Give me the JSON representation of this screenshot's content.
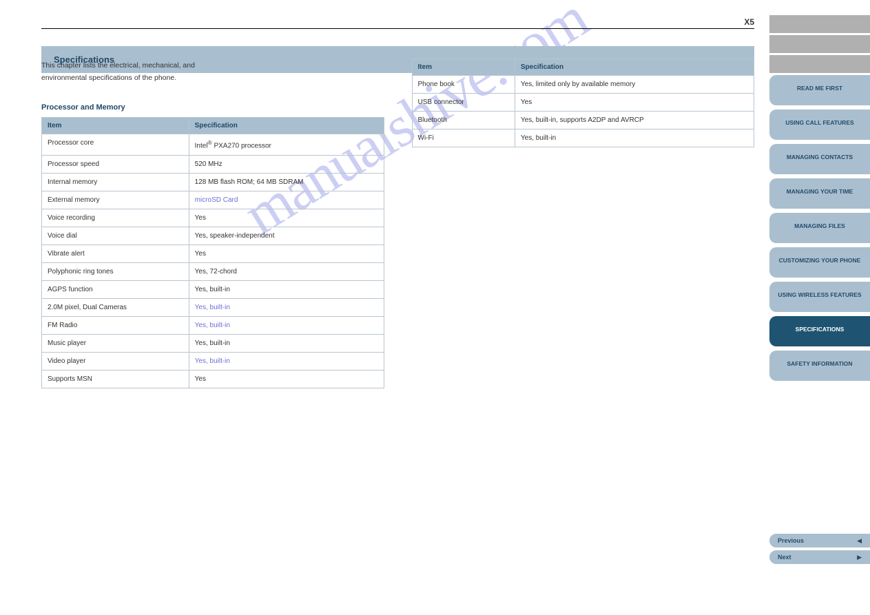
{
  "page_header": "X5",
  "section_title": "Specifications",
  "intro_lines": [
    "This chapter lists the electrical, mechanical, and",
    "environmental specifications of the phone."
  ],
  "left": {
    "subtitle": "Processor and Memory",
    "table": {
      "header_item": "Item",
      "header_spec": "Specification",
      "rows": [
        {
          "k": "Processor core",
          "v": "Intel<sup>®</sup>  PXA270 processor",
          "link": false
        },
        {
          "k": "Processor speed",
          "v": "520 MHz",
          "link": false
        },
        {
          "k": "Internal memory",
          "v": "128 MB flash ROM; 64 MB SDRAM",
          "link": false
        },
        {
          "k": "External memory",
          "v": "microSD Card",
          "link": "https://manualshive.com/"
        },
        {
          "k": "Voice recording",
          "v": "Yes",
          "link": false
        },
        {
          "k": "Voice dial",
          "v": "Yes, speaker-independent",
          "link": false
        },
        {
          "k": "Vibrate alert",
          "v": "Yes",
          "link": false
        },
        {
          "k": "Polyphonic ring tones",
          "v": "Yes, 72-chord",
          "link": false
        },
        {
          "k": "AGPS function",
          "v": "Yes, built-in",
          "link": false
        },
        {
          "k": "2.0M pixel, Dual Cameras",
          "v": "Yes, built-in",
          "link": "https://manualshive.com/"
        },
        {
          "k": "FM Radio",
          "v": "Yes, built-in",
          "link": "https://manualshive.com/"
        },
        {
          "k": "Music player",
          "v": "Yes, built-in",
          "link": false
        },
        {
          "k": "Video player",
          "v": "Yes, built-in",
          "link": "https://manualshive.com/"
        },
        {
          "k": "Supports MSN",
          "v": "Yes",
          "link": false
        }
      ]
    }
  },
  "right": {
    "table": {
      "header_item": "Item",
      "header_spec": "Specification",
      "rows": [
        {
          "k": "Phone book",
          "v": "Yes, limited only by available memory"
        },
        {
          "k": "USB connector",
          "v": "Yes"
        },
        {
          "k": "Bluetooth",
          "v": "Yes, built-in, supports A2DP and AVRCP"
        },
        {
          "k": "Wi-Fi",
          "v": "Yes, built-in"
        }
      ]
    }
  },
  "sidebar": {
    "gray": [
      "",
      "",
      ""
    ],
    "tabs": [
      {
        "t": "READ ME FIRST",
        "active": false
      },
      {
        "t": "USING CALL FEATURES",
        "active": false
      },
      {
        "t": "MANAGING CONTACTS",
        "active": false
      },
      {
        "t": "MANAGING YOUR TIME",
        "active": false
      },
      {
        "t": "MANAGING FILES",
        "active": false
      },
      {
        "t": "CUSTOMIZING YOUR PHONE",
        "active": false
      },
      {
        "t": "USING WIRELESS FEATURES",
        "active": false
      },
      {
        "t": "SPECIFICATIONS",
        "active": true
      },
      {
        "t": "SAFETY INFORMATION",
        "active": false
      }
    ],
    "prev": "Previous",
    "next": "Next",
    "prev_icon": "◀",
    "next_icon": "▶"
  },
  "watermark": "manualshive.com"
}
